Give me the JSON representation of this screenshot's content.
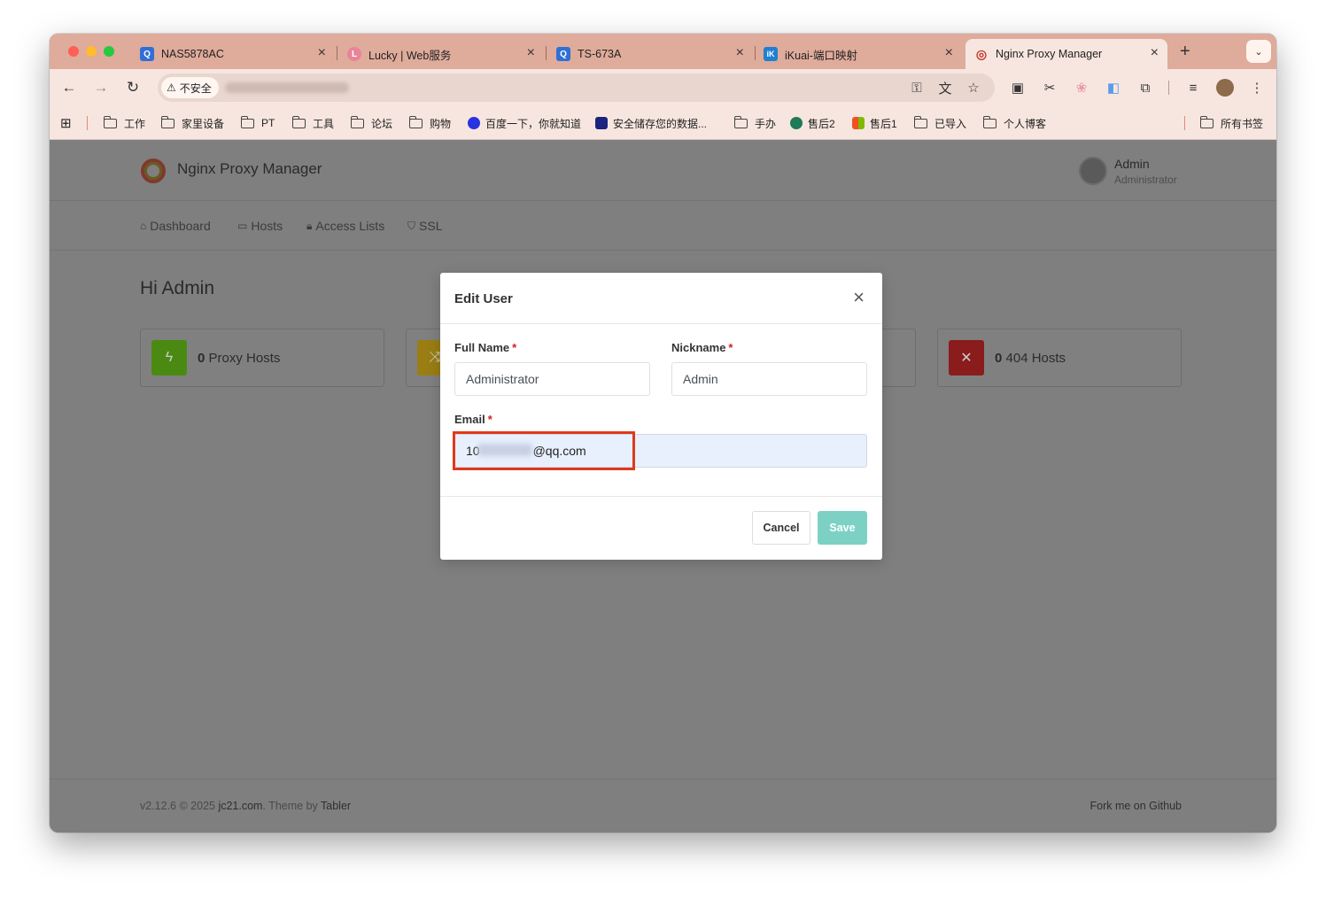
{
  "browser": {
    "tabs": [
      {
        "title": "NAS5878AC",
        "fav_color": "#2f6fd6",
        "fav_glyph": "Q"
      },
      {
        "title": "Lucky | Web服务",
        "fav_color": "#e8849a",
        "fav_glyph": "L"
      },
      {
        "title": "TS-673A",
        "fav_color": "#2f6fd6",
        "fav_glyph": "Q"
      },
      {
        "title": "iKuai-端口映射",
        "fav_color": "#1f7fd0",
        "fav_glyph": "iK"
      },
      {
        "title": "Nginx Proxy Manager",
        "fav_color": "#c0392b",
        "fav_glyph": "◎"
      }
    ],
    "new_tab": "+",
    "security_label": "不安全"
  },
  "bookmarks": [
    {
      "label": "工作",
      "type": "folder"
    },
    {
      "label": "家里设备",
      "type": "folder"
    },
    {
      "label": "PT",
      "type": "folder"
    },
    {
      "label": "工具",
      "type": "folder"
    },
    {
      "label": "论坛",
      "type": "folder"
    },
    {
      "label": "购物",
      "type": "folder"
    },
    {
      "label": "百度一下，你就知道",
      "type": "link",
      "color": "#2932e1"
    },
    {
      "label": "安全储存您的数据...",
      "type": "link",
      "color": "#1a237e"
    },
    {
      "label": "手办",
      "type": "folder"
    },
    {
      "label": "售后2",
      "type": "link",
      "color": "#1f7a5a"
    },
    {
      "label": "售后1",
      "type": "link",
      "color": "#f25022"
    },
    {
      "label": "已导入",
      "type": "folder"
    },
    {
      "label": "个人博客",
      "type": "folder"
    },
    {
      "label": "所有书签",
      "type": "folder"
    }
  ],
  "app": {
    "brand": "Nginx Proxy Manager",
    "user_name": "Admin",
    "user_role": "Administrator",
    "nav": {
      "dashboard": "Dashboard",
      "hosts": "Hosts",
      "access_lists": "Access Lists",
      "ssl": "SSL"
    },
    "greeting": "Hi Admin",
    "cards": {
      "proxy": {
        "count": "0",
        "label": "Proxy Hosts",
        "color": "#5eba00"
      },
      "redirection": {
        "color": "#f1c40f"
      },
      "notfound": {
        "count": "0",
        "label": "404 Hosts",
        "color": "#cd201f"
      }
    },
    "footer": {
      "version": "v2.12.6 © 2025 ",
      "company": "jc21.com",
      "theme_by": ". Theme by ",
      "theme": "Tabler",
      "fork": "Fork me on Github"
    }
  },
  "modal": {
    "title": "Edit User",
    "full_name_label": "Full Name",
    "nickname_label": "Nickname",
    "email_label": "Email",
    "required_mark": "*",
    "full_name_value": "Administrator",
    "nickname_value": "Admin",
    "email_prefix": "10",
    "email_suffix": "@qq.com",
    "cancel": "Cancel",
    "save": "Save"
  }
}
